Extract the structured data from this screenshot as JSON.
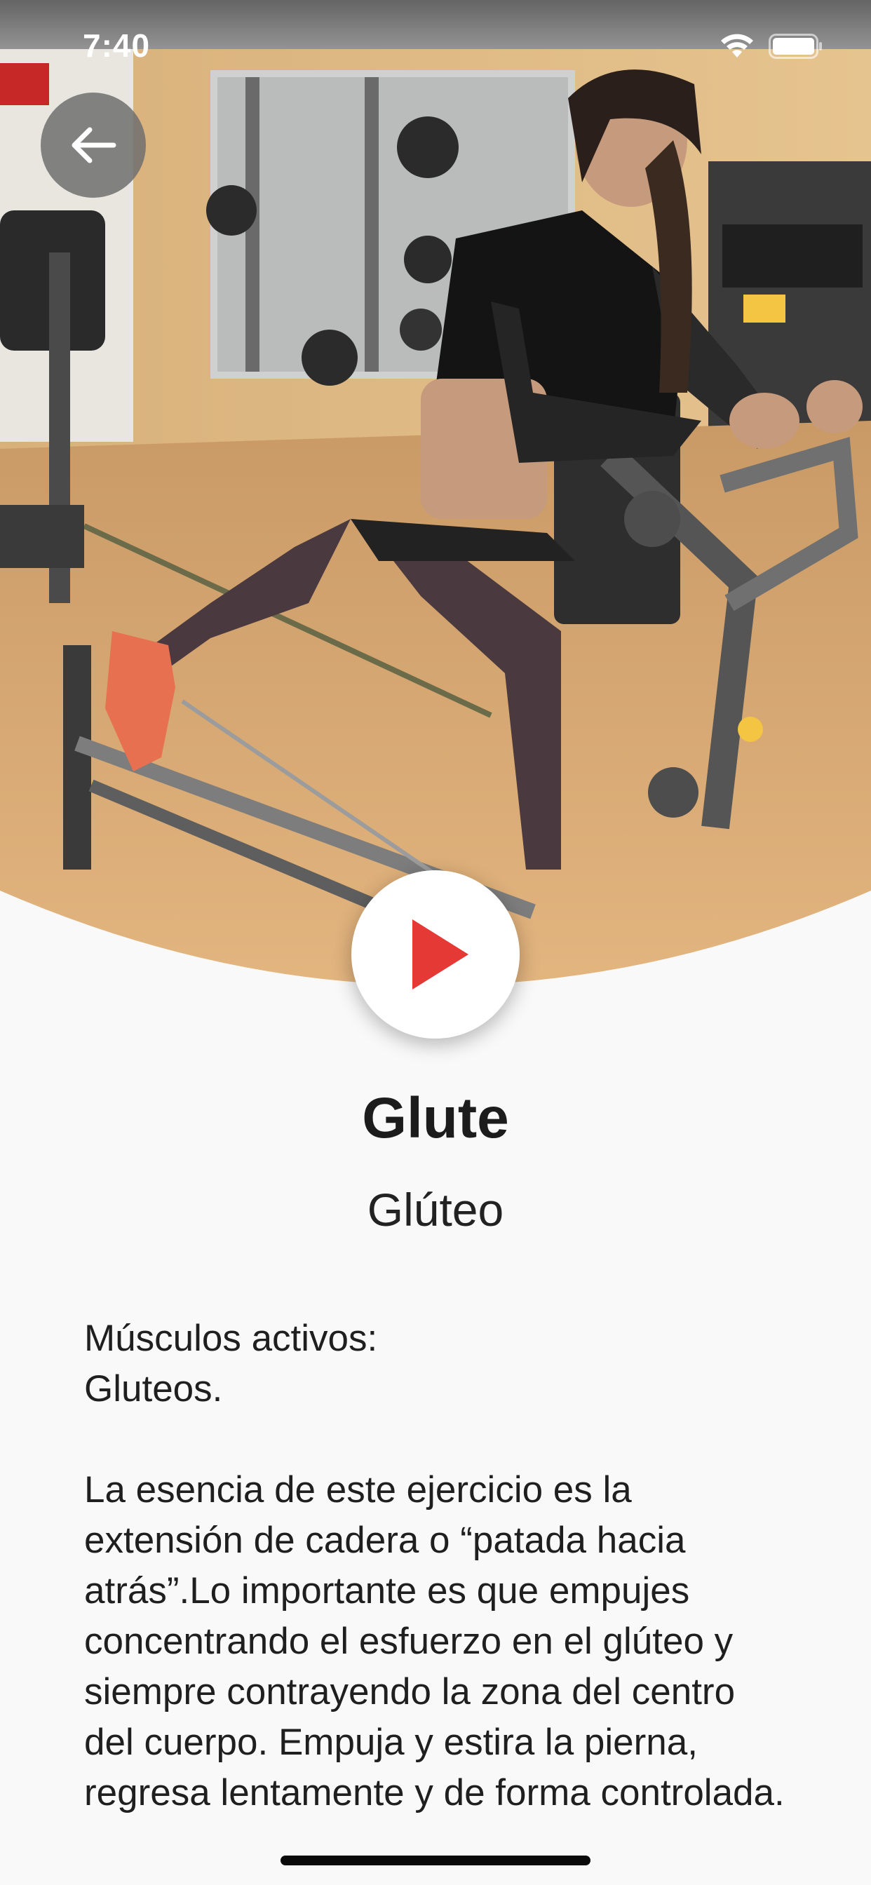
{
  "status_bar": {
    "time": "7:40",
    "icons": [
      "wifi-icon",
      "battery-icon"
    ]
  },
  "navigation": {
    "back_icon": "arrow-left-icon"
  },
  "hero": {
    "play_icon": "play-icon",
    "accent_color": "#e53935"
  },
  "exercise": {
    "title": "Glute",
    "subtitle": "Glúteo",
    "muscles_heading": "Músculos activos:",
    "muscles": "Gluteos.",
    "description": "La esencia de este ejercicio es la extensión de cadera o “patada hacia atrás”.Lo importante es que empujes concentrando el esfuerzo en el glúteo y siempre contrayendo la zona del centro del cuerpo. Empuja y estira la pierna, regresa lentamente y de forma controlada."
  }
}
